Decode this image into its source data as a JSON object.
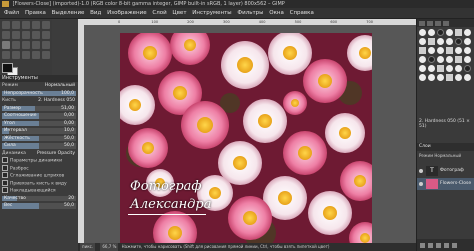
{
  "window": {
    "title": "[Flowers-Close] (imported)-1.0 (RGB color 8-bit gamma integer, GIMP built-in sRGB, 1 layer) 800x562 – GIMP"
  },
  "menu": [
    "Файл",
    "Правка",
    "Выделение",
    "Вид",
    "Изображение",
    "Слой",
    "Цвет",
    "Инструменты",
    "Фильтры",
    "Окна",
    "Справка"
  ],
  "left_panel": {
    "header": "Инструменты",
    "mode_label": "Режим",
    "mode_value": "Нормальный",
    "opacity_label": "Непрозрачность",
    "opacity_value": "100,0",
    "brush_label": "Кисть",
    "brush_value": "2. Hardness 050",
    "size_label": "Размер",
    "size_value": "51,00",
    "aspect_label": "Соотношение",
    "aspect_value": "0,00",
    "angle_label": "Угол",
    "angle_value": "0,00",
    "spacing_label": "Интервал",
    "spacing_value": "10,0",
    "hardness_label": "Жёсткость",
    "hardness_value": "50,0",
    "force_label": "Сила",
    "force_value": "50,0",
    "dynamics_label": "Динамика",
    "dynamics_value": "Pressure Opacity",
    "dyn_options": "Параметры динамики",
    "jitter": "Разброс",
    "smooth": "Сглаживание штрихов",
    "lock": "Привязать кисть к виду",
    "incremental": "Накладывающийся",
    "quality_label": "Качество",
    "quality_value": "20",
    "weight_label": "Вес",
    "weight_value": "50,0"
  },
  "canvas": {
    "caption_line1": "Фотограф",
    "caption_line2": "Александра"
  },
  "ruler": {
    "ticks": [
      "0",
      "100",
      "200",
      "300",
      "400",
      "500",
      "600",
      "700"
    ]
  },
  "statusbar": {
    "unit": "пикс.",
    "zoom": "66,7 %",
    "message": "Нажмите, чтобы нарисовать (Shift для рисования прямой линии, Ctrl, чтобы взять пипеткой цвет)"
  },
  "right_panel": {
    "brush_name": "2. Hardness 050 (51 × 51)",
    "layers_header": "Слои",
    "mode_label": "Режим Нормальный",
    "layers": [
      {
        "name": "Фотограф",
        "type": "text"
      },
      {
        "name": "Flowers-Close"
      }
    ]
  }
}
